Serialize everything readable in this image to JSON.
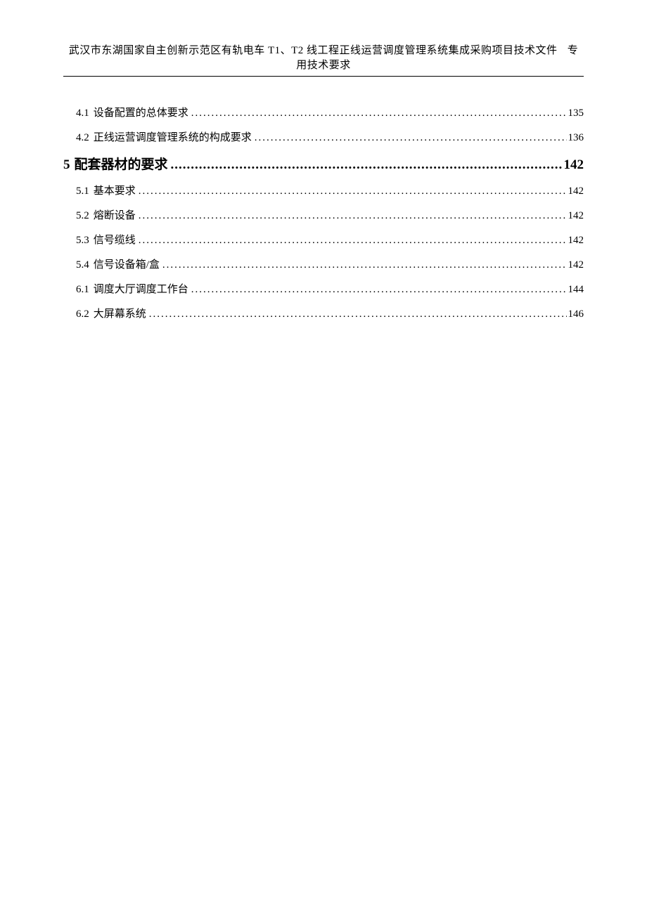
{
  "header": {
    "main": "武汉市东湖国家自主创新示范区有轨电车 T1、T2 线工程正线运营调度管理系统集成采购项目技术文件",
    "sub": "专用技术要求"
  },
  "toc": {
    "entries": [
      {
        "level": "sub",
        "num": "4.1",
        "title": "设备配置的总体要求",
        "page": "135"
      },
      {
        "level": "sub",
        "num": "4.2",
        "title": "正线运营调度管理系统的构成要求",
        "page": "136"
      },
      {
        "level": "main",
        "num": "5",
        "title": "配套器材的要求",
        "page": "142"
      },
      {
        "level": "sub",
        "num": "5.1",
        "title": "基本要求",
        "page": "142"
      },
      {
        "level": "sub",
        "num": "5.2",
        "title": "熔断设备",
        "page": "142"
      },
      {
        "level": "sub",
        "num": "5.3",
        "title": "信号缆线",
        "page": "142"
      },
      {
        "level": "sub",
        "num": "5.4",
        "title": "信号设备箱/盒",
        "page": "142"
      },
      {
        "level": "sub",
        "num": "6.1",
        "title": "调度大厅调度工作台",
        "page": "144"
      },
      {
        "level": "sub",
        "num": "6.2",
        "title": "大屏幕系统",
        "page": "146"
      }
    ]
  }
}
